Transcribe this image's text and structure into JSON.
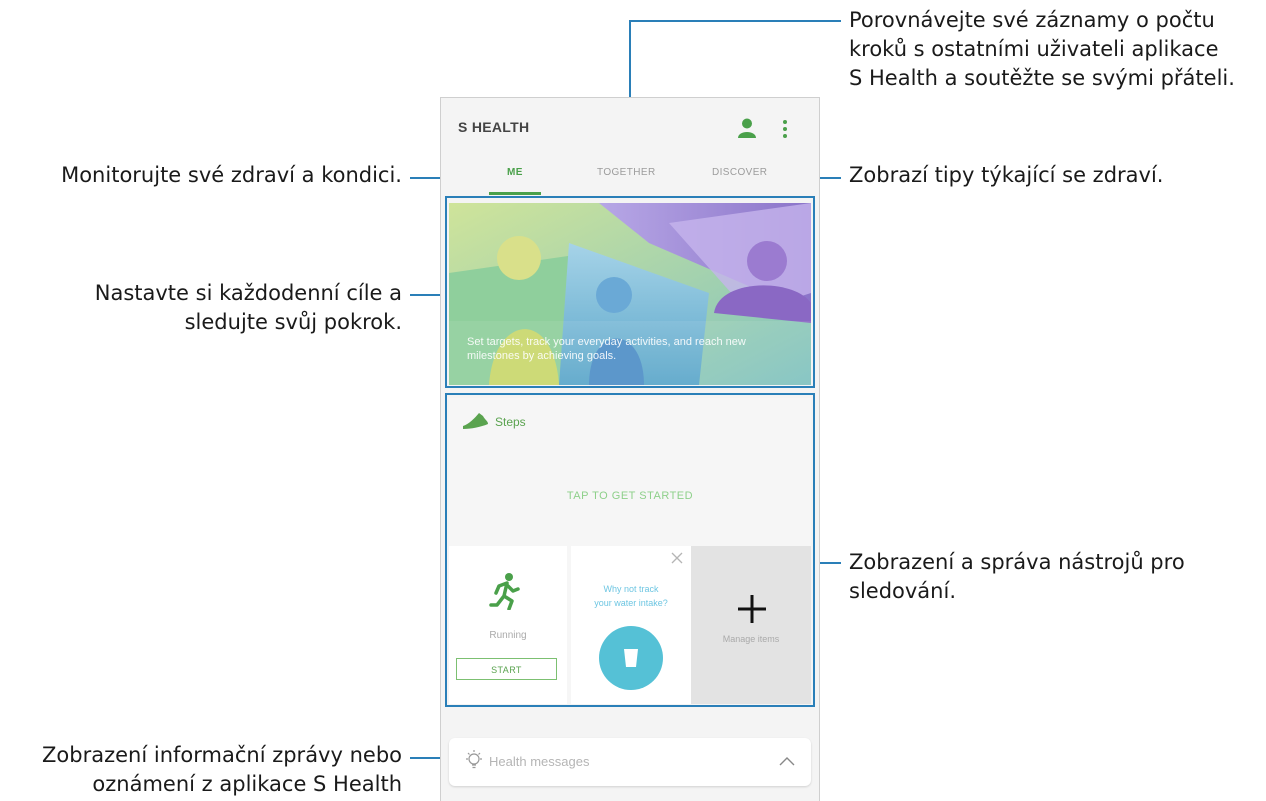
{
  "annotations": {
    "compare_line1": "Porovnávejte své záznamy o počtu",
    "compare_line2": "kroků s ostatními uživateli aplikace",
    "compare_line3": "S Health a soutěžte se svými přáteli.",
    "monitor": "Monitorujte své zdraví a kondici.",
    "tips": "Zobrazí tipy týkající se zdraví.",
    "goals_line1": "Nastavte si každodenní cíle a",
    "goals_line2": "sledujte svůj pokrok.",
    "trackers_line1": "Zobrazení a správa nástrojů pro",
    "trackers_line2": "sledování.",
    "messages_line1": "Zobrazení informační zprávy nebo",
    "messages_line2": "oznámení z aplikace S Health"
  },
  "app": {
    "title": "S HEALTH",
    "tabs": [
      "ME",
      "TOGETHER",
      "DISCOVER"
    ],
    "active_tab": "ME"
  },
  "banner": {
    "text": "Set targets, track your everyday activities, and reach new milestones by achieving goals."
  },
  "steps": {
    "label": "Steps",
    "prompt": "TAP TO GET STARTED"
  },
  "tiles": {
    "running_label": "Running",
    "start_button": "START",
    "water_prompt_line1": "Why not track",
    "water_prompt_line2": "your water intake?",
    "manage_label": "Manage items"
  },
  "health_messages": {
    "label": "Health messages"
  },
  "icons": [
    "profile-icon",
    "more-vert-icon",
    "shoe-icon",
    "running-icon",
    "close-icon",
    "cup-icon",
    "plus-icon",
    "bulb-icon",
    "chevron-up-icon"
  ],
  "colors": {
    "accent_green": "#4aa04a",
    "callout_blue": "#2a7fb8",
    "water_blue": "#55c1d6"
  }
}
